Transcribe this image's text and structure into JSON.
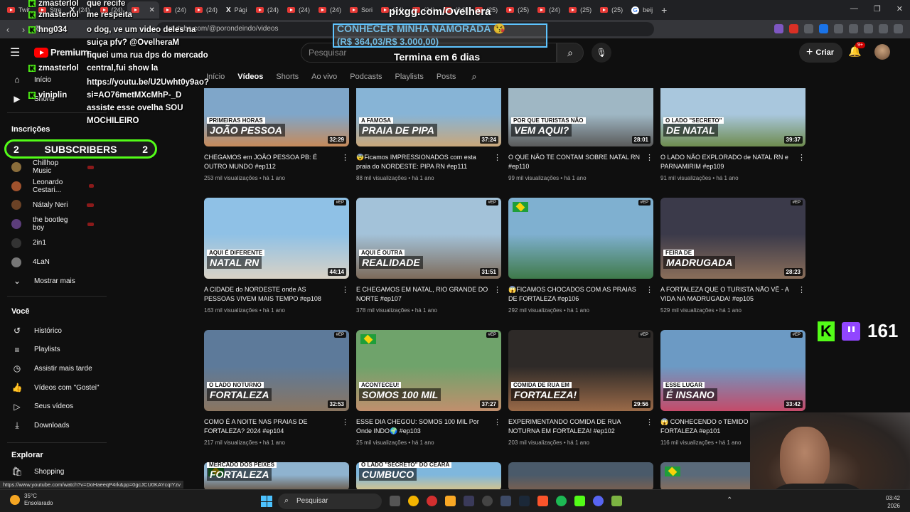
{
  "browser": {
    "tabs": [
      {
        "label": "Twit",
        "icon": "twitch"
      },
      {
        "label": "Stre",
        "icon": "youtube"
      },
      {
        "label": "(24)",
        "icon": "x"
      },
      {
        "label": "(24)",
        "icon": "youtube"
      },
      {
        "label": "",
        "icon": "youtube",
        "active": true
      },
      {
        "label": "(24)",
        "icon": "youtube"
      },
      {
        "label": "(24)",
        "icon": "youtube"
      },
      {
        "label": "Pági",
        "icon": "x"
      },
      {
        "label": "(24)",
        "icon": "youtube"
      },
      {
        "label": "(24)",
        "icon": "youtube"
      },
      {
        "label": "(24)",
        "icon": "youtube"
      },
      {
        "label": "Sori",
        "icon": "youtube"
      },
      {
        "label": "(24)",
        "icon": "youtube"
      },
      {
        "label": "(24)",
        "icon": "youtube"
      },
      {
        "label": "(24)",
        "icon": "youtube"
      },
      {
        "label": "(25)",
        "icon": "youtube"
      },
      {
        "label": "(25)",
        "icon": "youtube"
      },
      {
        "label": "(24)",
        "icon": "youtube"
      },
      {
        "label": "(25)",
        "icon": "youtube"
      },
      {
        "label": "(25)",
        "icon": "youtube"
      },
      {
        "label": "beij",
        "icon": "google"
      }
    ],
    "new_tab": "+",
    "url": "youtube.com/@porondeindo/videos",
    "status_url": "https://www.youtube.com/watch?v=DoHaeeqP4rk&pp=0gcJCU0KAYcqIYzv"
  },
  "youtube": {
    "logo": "Premium",
    "search_placeholder": "Pesquisar",
    "create_label": "Criar",
    "notif_badge": "9+",
    "channel_tabs": [
      "Início",
      "Vídeos",
      "Shorts",
      "Ao vivo",
      "Podcasts",
      "Playlists",
      "Posts"
    ],
    "active_tab": "Vídeos"
  },
  "sidebar": {
    "top": [
      {
        "label": "Início",
        "icon": "home-icon"
      },
      {
        "label": "Shorts",
        "icon": "shorts-icon"
      }
    ],
    "subs_heading": "Inscrições",
    "subs": [
      {
        "label": "Chillhop Music",
        "color": "#8a6d3b"
      },
      {
        "label": "Leonardo Cestari...",
        "color": "#a0522d"
      },
      {
        "label": "Nátaly Neri",
        "color": "#6b4226"
      },
      {
        "label": "the bootleg boy",
        "color": "#5c3d7a"
      },
      {
        "label": "2in1",
        "color": "#333333"
      },
      {
        "label": "4LaN",
        "color": "#777777"
      }
    ],
    "show_more": "Mostrar mais",
    "you_heading": "Você",
    "you_items": [
      {
        "label": "Histórico",
        "icon": "history-icon"
      },
      {
        "label": "Playlists",
        "icon": "playlists-icon"
      },
      {
        "label": "Assistir mais tarde",
        "icon": "watch-later-icon"
      },
      {
        "label": "Vídeos com \"Gostei\"",
        "icon": "like-icon"
      },
      {
        "label": "Seus vídeos",
        "icon": "your-videos-icon"
      },
      {
        "label": "Downloads",
        "icon": "download-icon"
      }
    ],
    "explore_heading": "Explorar",
    "explore_items": [
      {
        "label": "Shopping",
        "icon": "shopping-icon"
      }
    ]
  },
  "videos": [
    {
      "title": "CHEGAMOS em JOÃO PESSOA PB: É OUTRO MUNDO #ep112",
      "views": "253 mil visualizações",
      "age": "há 1 ano",
      "duration": "32:29",
      "thumb_text": "JOÃO PESSOA",
      "thumb_sub": "PRIMEIRAS HORAS",
      "colors": [
        "#7fa6c9",
        "#c68a5a"
      ]
    },
    {
      "title": "😨Ficamos IMPRESSIONADOS com esta praia do NORDESTE: PIPA RN #ep111",
      "views": "88 mil visualizações",
      "age": "há 1 ano",
      "duration": "37:24",
      "thumb_text": "PRAIA DE PIPA",
      "thumb_sub": "A FAMOSA",
      "colors": [
        "#87b4d6",
        "#c9a77a"
      ]
    },
    {
      "title": "O QUE NÃO TE CONTAM SOBRE NATAL RN #ep110",
      "views": "99 mil visualizações",
      "age": "há 1 ano",
      "duration": "28:01",
      "thumb_text": "VEM AQUI?",
      "thumb_sub": "POR QUE TURISTAS NÃO",
      "colors": [
        "#9fb7c4",
        "#5a5a5a"
      ]
    },
    {
      "title": "O LADO NÃO EXPLORADO de NATAL RN e PARNAMIRIM #ep109",
      "views": "91 mil visualizações",
      "age": "há 1 ano",
      "duration": "39:37",
      "thumb_text": "DE NATAL",
      "thumb_sub": "O LADO \"SECRETO\"",
      "colors": [
        "#a9c7dd",
        "#6e8b4e"
      ]
    },
    {
      "title": "A CIDADE do NORDESTE onde AS PESSOAS VIVEM MAIS TEMPO #ep108",
      "views": "163 mil visualizações",
      "age": "há 1 ano",
      "duration": "44:14",
      "thumb_text": "NATAL RN",
      "thumb_sub": "AQUI É DIFERENTE",
      "colors": [
        "#8fc1e6",
        "#d9d2c5"
      ]
    },
    {
      "title": "E CHEGAMOS EM NATAL, RIO GRANDE DO NORTE #ep107",
      "views": "378 mil visualizações",
      "age": "há 1 ano",
      "duration": "31:51",
      "thumb_text": "REALIDADE",
      "thumb_sub": "AQUI É OUTRA",
      "colors": [
        "#a3c2d9",
        "#7d6b5a"
      ]
    },
    {
      "title": "😱FICAMOS CHOCADOS COM AS PRAIAS DE FORTALEZA #ep106",
      "views": "292 mil visualizações",
      "age": "há 1 ano",
      "duration": "",
      "thumb_text": "",
      "thumb_sub": "",
      "colors": [
        "#7fb0d0",
        "#3f7a4a"
      ]
    },
    {
      "title": "A FORTALEZA QUE O TURISTA NÃO VÊ - A VIDA NA MADRUGADA! #ep105",
      "views": "529 mil visualizações",
      "age": "há 1 ano",
      "duration": "28:23",
      "thumb_text": "MADRUGADA",
      "thumb_sub": "FEIRA DE",
      "colors": [
        "#3b3a4a",
        "#8a6e5a"
      ]
    },
    {
      "title": "COMO É A NOITE NAS PRAIAS DE FORTALEZA? 2024 #ep104",
      "views": "217 mil visualizações",
      "age": "há 1 ano",
      "duration": "32:53",
      "thumb_text": "FORTALEZA",
      "thumb_sub": "O LADO NOTURNO",
      "colors": [
        "#5d7a9a",
        "#8a7560"
      ]
    },
    {
      "title": "ESSE DIA CHEGOU: SOMOS 100 MIL Por Onde INDO🌍 #ep103",
      "views": "25 mil visualizações",
      "age": "há 1 ano",
      "duration": "37:27",
      "thumb_text": "SOMOS 100 MIL",
      "thumb_sub": "ACONTECEU!",
      "colors": [
        "#6fa36b",
        "#c08f6d"
      ]
    },
    {
      "title": "EXPERIMENTANDO COMIDA DE RUA NOTURNA EM FORTALEZA! #ep102",
      "views": "203 mil visualizações",
      "age": "há 1 ano",
      "duration": "29:56",
      "thumb_text": "FORTALEZA!",
      "thumb_sub": "COMIDA DE RUA EM",
      "colors": [
        "#2e2a28",
        "#9a6a48"
      ]
    },
    {
      "title": "😱 CONHECENDO o TEMIDO BEACH P... de FORTALEZA #ep101",
      "views": "116 mil visualizações",
      "age": "há 1 ano",
      "duration": "33:42",
      "thumb_text": "É INSANO",
      "thumb_sub": "ESSE LUGAR",
      "colors": [
        "#6c9ac4",
        "#c44b6a"
      ]
    },
    {
      "title": "",
      "views": "",
      "age": "",
      "duration": "",
      "thumb_text": "FORTALEZA",
      "thumb_sub": "MERCADO DOS PEIXES",
      "colors": [
        "#8fb3cf",
        "#6a5a4a"
      ]
    },
    {
      "title": "",
      "views": "",
      "age": "",
      "duration": "",
      "thumb_text": "CUMBUCO",
      "thumb_sub": "O LADO \"SECRETO\" DO CEARÁ",
      "colors": [
        "#7fb7dd",
        "#d8c48a"
      ]
    },
    {
      "title": "",
      "views": "",
      "age": "",
      "duration": "",
      "thumb_text": "",
      "thumb_sub": "",
      "colors": [
        "#4a5a6a",
        "#7a6050"
      ]
    },
    {
      "title": "",
      "views": "",
      "age": "",
      "duration": "",
      "thumb_text": "",
      "thumb_sub": "",
      "colors": [
        "#5a6a7a",
        "#8a6e5a"
      ]
    }
  ],
  "overlay": {
    "chat": [
      {
        "user": "zmasterlol",
        "text": "que recife"
      },
      {
        "user": "zmasterlol",
        "text": "me respeita"
      },
      {
        "user": "hng034",
        "text": "o dog, ve um video deles na"
      },
      {
        "user": "",
        "text": "suiça pfv? @OvelheraM"
      },
      {
        "user": "",
        "text": "fiquei uma rua dps do mercado"
      },
      {
        "user": "zmasterlol",
        "text": "central,fui show la"
      },
      {
        "user": "",
        "text": "https://youtu.be/U2Uwht0y9ao?"
      },
      {
        "user": "viniplin",
        "text": "si=AO76metMXcMhP-_D"
      },
      {
        "user": "",
        "text": "assiste esse ovelha SOU"
      },
      {
        "user": "",
        "text": "MOCHILEIRO"
      }
    ],
    "pixgg": "pixgg.com/Ovelhera",
    "goal_title": "CONHECER MINHA NAMORADA 😘",
    "goal_amount": "(R$ 364,03/R$ 3.000,00)",
    "goal_ends": "Termina em 6 dias",
    "subs_left": "2",
    "subs_label": "SUBSCRIBERS",
    "subs_right": "2",
    "viewers": "161"
  },
  "taskbar": {
    "temperature": "35°C",
    "weather": "Ensolarado",
    "search": "Pesquisar",
    "time": "03:42",
    "date": "2026"
  }
}
